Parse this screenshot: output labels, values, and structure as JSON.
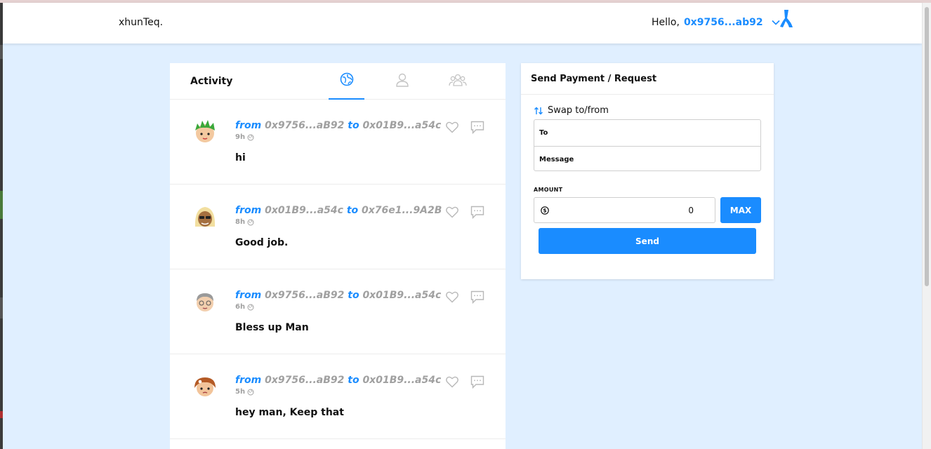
{
  "header": {
    "brand": "xhunTeq.",
    "greeting": "Hello,",
    "account": "0x9756...ab92"
  },
  "activity": {
    "title": "Activity",
    "tabs": [
      {
        "name": "global-icon",
        "active": true
      },
      {
        "name": "user-icon",
        "active": false
      },
      {
        "name": "friends-icon",
        "active": false
      }
    ],
    "items": [
      {
        "from_kw": "from",
        "from": "0x9756...aB92",
        "to_kw": "to",
        "to": "0x01B9...a54c",
        "time": "9h",
        "message": "hi",
        "avatar": "green-hair-avatar"
      },
      {
        "from_kw": "from",
        "from": "0x01B9...a54c",
        "to_kw": "to",
        "to": "0x76e1...9A2B",
        "time": "8h",
        "message": "Good job.",
        "avatar": "blonde-hair-avatar"
      },
      {
        "from_kw": "from",
        "from": "0x9756...aB92",
        "to_kw": "to",
        "to": "0x01B9...a54c",
        "time": "6h",
        "message": "Bless up Man",
        "avatar": "grey-hair-avatar"
      },
      {
        "from_kw": "from",
        "from": "0x9756...aB92",
        "to_kw": "to",
        "to": "0x01B9...a54c",
        "time": "5h",
        "message": "hey man, Keep that",
        "avatar": "brown-hair-avatar"
      }
    ]
  },
  "payment": {
    "title": "Send Payment / Request",
    "swap_label": "Swap to/from",
    "to_label": "To",
    "message_label": "Message",
    "amount_label": "AMOUNT",
    "amount_value": "0",
    "max_label": "MAX",
    "send_label": "Send"
  },
  "colors": {
    "accent": "#1a8cff",
    "background": "#e0efff",
    "muted": "#a0a0a0"
  }
}
